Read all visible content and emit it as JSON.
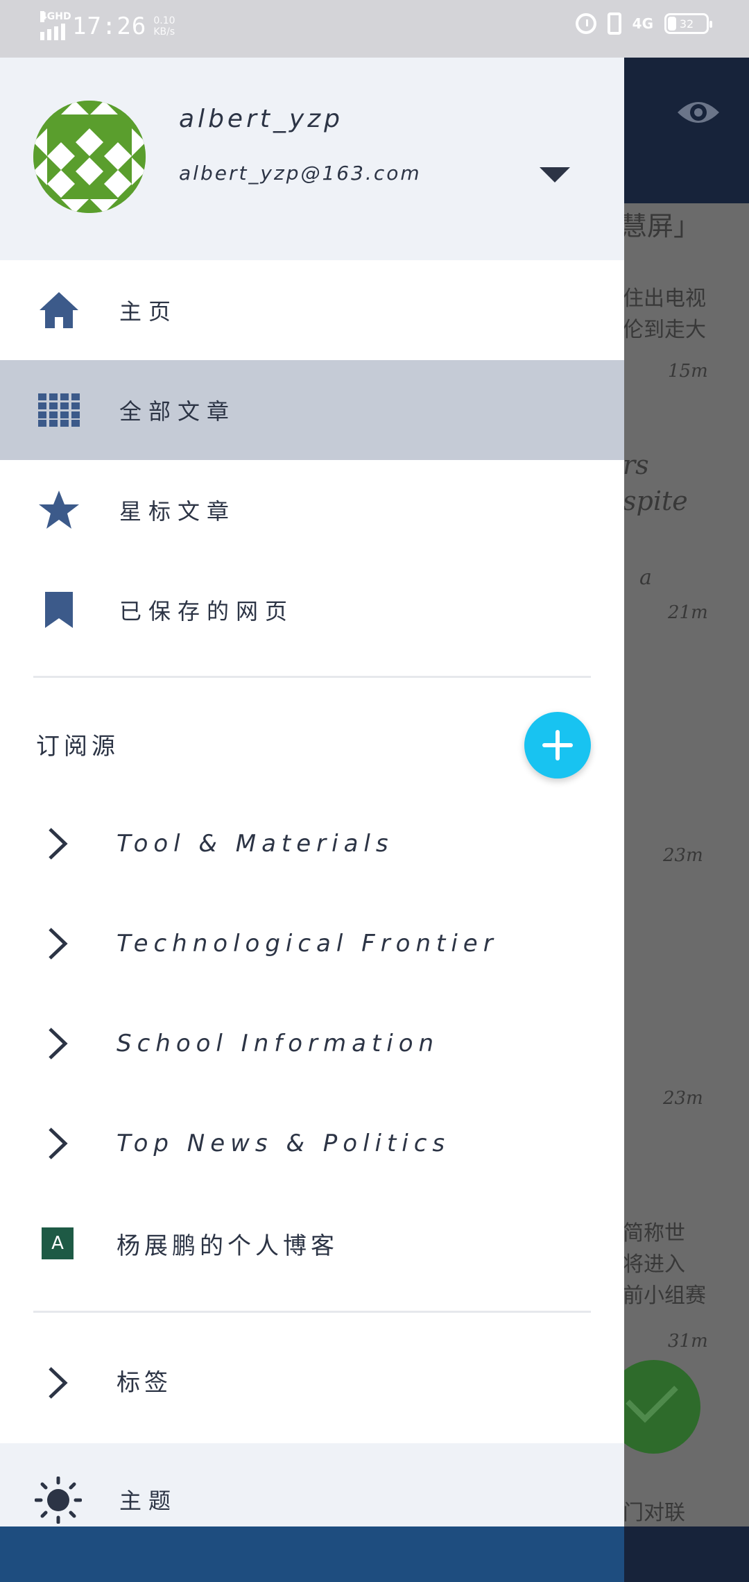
{
  "status_bar": {
    "network_badge": "4GHD",
    "time": "17:26",
    "speed_value": "0.10",
    "speed_unit": "KB/s",
    "network_right": "4G",
    "battery": "32"
  },
  "profile": {
    "username": "albert_yzp",
    "email": "albert_yzp@163.com"
  },
  "nav": [
    {
      "label": "主页",
      "icon": "home-icon"
    },
    {
      "label": "全部文章",
      "icon": "grid-icon"
    },
    {
      "label": "星标文章",
      "icon": "star-icon"
    },
    {
      "label": "已保存的网页",
      "icon": "bookmark-icon"
    }
  ],
  "feeds": {
    "section_title": "订阅源",
    "items": [
      {
        "label": "Tool & Materials"
      },
      {
        "label": "Technological Frontier"
      },
      {
        "label": "School Information"
      },
      {
        "label": "Top News & Politics"
      },
      {
        "label": "杨展鹏的个人博客",
        "badge": "A"
      }
    ]
  },
  "tags_label": "标签",
  "theme_label": "主题",
  "background": {
    "lines": [
      "慧屏」",
      "住出电视",
      "伦到走大",
      "rs",
      "spite",
      "a",
      "简称世",
      "将进入",
      "前小组赛",
      "门对联"
    ],
    "times": [
      "15m",
      "21m",
      "23m",
      "23m",
      "31m"
    ]
  },
  "colors": {
    "drawer_text": "#2c3445",
    "active_bg": "#c5cbd6",
    "fab_add": "#18c3f1",
    "header_dark": "#17233a"
  }
}
